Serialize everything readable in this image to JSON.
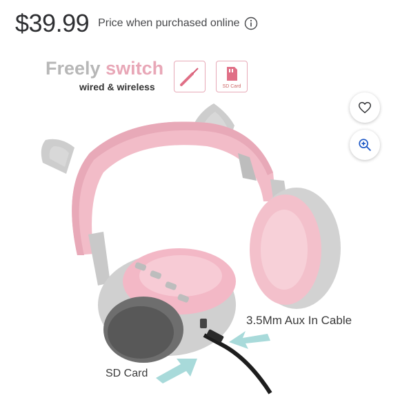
{
  "price": {
    "amount": "$39.99",
    "note": "Price when purchased online"
  },
  "promo": {
    "word1": "Freely",
    "word2": "switch",
    "tagline": "wired & wireless",
    "sd_caption": "SD Card"
  },
  "actions": {
    "favorite_icon": "heart-icon",
    "zoom_icon": "zoom-in-icon"
  },
  "callouts": {
    "aux": "3.5Mm Aux In Cable",
    "sd": "SD Card"
  },
  "colors": {
    "headband_pink": "#f2bcc8",
    "shell_grey": "#cfcfcf",
    "arrow_teal": "#9fd6d6",
    "accent_blue": "#1a56c6"
  }
}
